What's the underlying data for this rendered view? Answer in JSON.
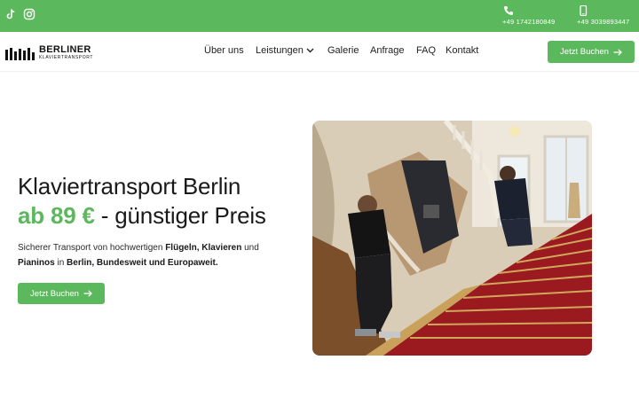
{
  "topbar": {
    "social": [
      "tiktok-icon",
      "instagram-icon"
    ],
    "contacts": [
      {
        "icon": "phone-icon",
        "number": "+49 1742180849"
      },
      {
        "icon": "mobile-icon",
        "number": "+49 3039893447"
      }
    ],
    "color": "#5cb85c"
  },
  "logo": {
    "title": "BERLINER",
    "subtitle": "KLAVIERTRANSPORT"
  },
  "nav": {
    "items": [
      "Über uns",
      "Leistungen",
      "Galerie",
      "Anfrage",
      "FAQ",
      "Kontakt"
    ],
    "cta": "Jetzt Buchen"
  },
  "hero": {
    "heading_line1": "Klaviertransport Berlin",
    "price": "ab 89 €",
    "price_suffix": " - günstiger Preis",
    "desc": {
      "t1": "Sicherer Transport von hochwertigen ",
      "b1": "Flügeln, Klavieren",
      "t2": " und ",
      "b2": "Pianinos",
      "t3": " in ",
      "b3": "Berlin, Bundesweit und Europaweit."
    },
    "cta": "Jetzt Buchen",
    "image_icon": "piano-moving-photo"
  },
  "colors": {
    "accent": "#5cb85c",
    "text": "#1a1a1a"
  }
}
